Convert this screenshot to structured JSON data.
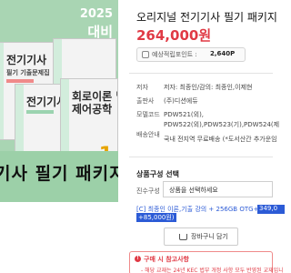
{
  "promo": {
    "year": "2025",
    "daebi": "대비",
    "banner_text": "기사 필기 패키지",
    "books": [
      {
        "title": "전기기사",
        "subtitle": "필기 기출문제집"
      },
      {
        "title": "전기기사",
        "subtitle": ""
      },
      {
        "title": "2",
        "subtitle": ""
      },
      {
        "title": "회로이론 및",
        "subtitle": "제어공학",
        "number": "1"
      }
    ]
  },
  "product": {
    "title": "오리지널 전기기사 필기 패키지",
    "price": "264,000원",
    "points_label": "예상적립포인트 :",
    "points_value": "2,640P"
  },
  "details": {
    "author_label": "저자",
    "author_value": "저자: 최종인/감의: 최종인,이제현",
    "publisher_label": "출판사",
    "publisher_value": "(주)디션에듀",
    "model_label": "모델코드",
    "model_value_1": "PDW521(외),",
    "model_value_2": "PDW522(외),PDW523(기),PDW524(제",
    "shipping_label": "배송안내",
    "shipping_value": "국내 전지역 무료배송 (*도서산간 추가운임"
  },
  "options": {
    "heading": "상품구성 선택",
    "label": "진수구성",
    "placeholder": "상품을 선택하세요",
    "selected_item": "[C] 최종인 이론,기출 강의 + 256GB OTG+필기포켓",
    "selected_price": "349,0",
    "selected_bonus": "+85,000원)"
  },
  "cart": {
    "label": "장바구니 담기"
  },
  "notice": {
    "title": "구매 시 참고사항",
    "body": "- 해당 교재는 24년 KEC 법부 개정 사항 모두 반영된 교재입니"
  },
  "colors": {
    "price": "#e03a45",
    "accent": "#2c5bd6",
    "promo_bg": "#a9d5b3"
  }
}
